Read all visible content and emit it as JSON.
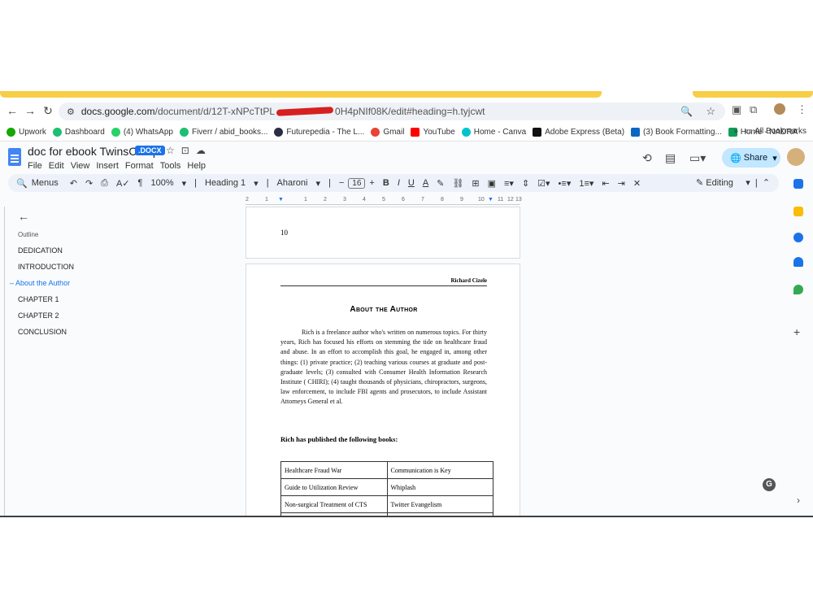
{
  "browser": {
    "url_host": "docs.google.com",
    "url_path_start": "/document/d/12T-xNPcTtPL",
    "url_path_end": "0H4pNIf08K/edit#heading=h.tyjcwt",
    "zoom_icon": "zoom-icon",
    "bookmarks": [
      "Upwork",
      "Dashboard",
      "(4) WhatsApp",
      "Fiverr / abid_books...",
      "Futurepedia - The L...",
      "Gmail",
      "YouTube",
      "Home - Canva",
      "Adobe Express (Beta)",
      "(3) Book Formatting...",
      "Home - NADRA"
    ],
    "bookmark_colors": [
      "#14a800",
      "#1dbf73",
      "#25d366",
      "#1dbf73",
      "#2b2d42",
      "#ea4335",
      "#ff0000",
      "#00c4cc",
      "#111111",
      "#0a66c2",
      "#0f9d58"
    ],
    "more_bookmarks": "»",
    "all_bookmarks": "All Bookmarks"
  },
  "docs": {
    "title": "doc for ebook TwinsComp",
    "badge": ".DOCX",
    "menu": [
      "File",
      "Edit",
      "View",
      "Insert",
      "Format",
      "Tools",
      "Help"
    ],
    "share_label": "Share",
    "toolbar": {
      "menus_label": "Menus",
      "zoom": "100%",
      "style": "Heading 1",
      "font": "Aharoni",
      "font_size": "16",
      "mode": "Editing"
    }
  },
  "outline": {
    "label": "Outline",
    "items": [
      "DEDICATION",
      "INTRODUCTION",
      "About the Author",
      "CHAPTER 1",
      "CHAPTER 2",
      "CONCLUSION"
    ],
    "active_index": 2
  },
  "page1": {
    "page_number": "10"
  },
  "page2": {
    "running_header": "Richard Cizele",
    "heading": "About the Author",
    "bio": "Rich is a freelance author who's written on numerous topics. For thirty years, Rich has focused his efforts on stemming the tide on healthcare fraud and abuse. In an effort to accomplish this goal, he engaged in, among other things: (1) private practice; (2) teaching various courses at graduate and post-graduate levels; (3) consulted with Consumer Health Information Research Institute ( CHIRI); (4) taught thousands of physicians, chiropractors, surgeons, law enforcement, to include FBI agents and prosecutors, to include Assistant Attorneys General et al.",
    "books_heading": "Rich has published the following books:",
    "books": [
      [
        "Healthcare Fraud War",
        "Communication is Key"
      ],
      [
        "Guide to Utilization Review",
        "Whiplash"
      ],
      [
        "Non-surgical Treatment of CTS",
        "Twitter Evangelism"
      ],
      [
        "",
        ""
      ]
    ]
  },
  "colors": {
    "accent": "#1a73e8",
    "yellow_bar": "#f7ce46",
    "share_bg": "#c2e7ff"
  }
}
